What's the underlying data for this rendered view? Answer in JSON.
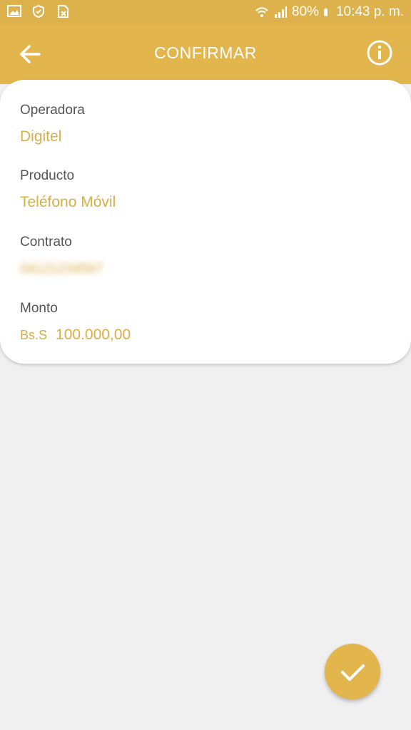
{
  "status_bar": {
    "battery": "80%",
    "time": "10:43 p. m."
  },
  "header": {
    "title": "CONFIRMAR"
  },
  "details": {
    "operator_label": "Operadora",
    "operator_value": "Digitel",
    "product_label": "Producto",
    "product_value": "Teléfono Móvil",
    "contract_label": "Contrato",
    "contract_value": "04121234567",
    "amount_label": "Monto",
    "currency": "Bs.S",
    "amount_value": "100.000,00"
  },
  "colors": {
    "accent": "#e2b54d",
    "value_text": "#d9ae44",
    "background": "#f0f0f0",
    "card": "#ffffff"
  },
  "icons": {
    "back": "arrow-left-icon",
    "info": "info-icon",
    "confirm": "check-icon"
  }
}
